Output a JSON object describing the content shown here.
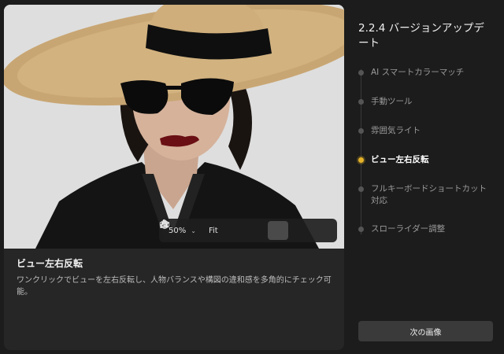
{
  "sidebar": {
    "title": "2.2.4 バージョンアップデート",
    "items": [
      {
        "label": "AI スマートカラーマッチ",
        "active": false
      },
      {
        "label": "手動ツール",
        "active": false
      },
      {
        "label": "雰囲気ライト",
        "active": false
      },
      {
        "label": "ビュー左右反転",
        "active": true
      },
      {
        "label": "フルキーボードショートカット対応",
        "active": false
      },
      {
        "label": "スローライダー調整",
        "active": false
      }
    ],
    "next_label": "次の画像"
  },
  "toolbar": {
    "zoom": "50%",
    "fit_label": "Fit",
    "icons": [
      "hand-icon",
      "ruler-icon",
      "flip-icon",
      "pointer-hand-icon",
      "eraser-icon"
    ]
  },
  "feature": {
    "title": "ビュー左右反転",
    "description": "ワンクリックでビューを左右反転し、人物バランスや構図の違和感を多角的にチェック可能。"
  },
  "colors": {
    "accent": "#e5b229",
    "background": "#1c1c1c",
    "card": "#262626"
  }
}
